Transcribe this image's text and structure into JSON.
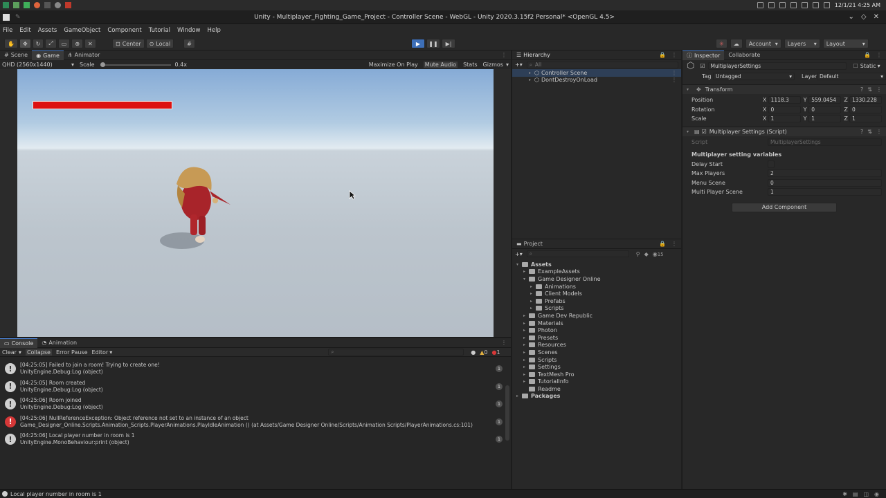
{
  "os_bar": {
    "datetime": "12/1/21   4:25 AM"
  },
  "window": {
    "title": "Unity - Multiplayer_Fighting_Game_Project - Controller Scene - WebGL - Unity 2020.3.15f2 Personal* <OpenGL 4.5>"
  },
  "menu": [
    "File",
    "Edit",
    "Assets",
    "GameObject",
    "Component",
    "Tutorial",
    "Window",
    "Help"
  ],
  "toolbar": {
    "pivot_label": "Center",
    "space_label": "Local",
    "account_label": "Account",
    "layers_label": "Layers",
    "layout_label": "Layout"
  },
  "scene_panel": {
    "tabs": [
      "Scene",
      "Game",
      "Animator"
    ],
    "resolution": "QHD (2560x1440)",
    "scale_label": "Scale",
    "scale_value": "0.4x",
    "options": [
      "Maximize On Play",
      "Mute Audio",
      "Stats",
      "Gizmos"
    ],
    "health": 1.0
  },
  "hierarchy": {
    "title": "Hierarchy",
    "search_placeholder": "All",
    "items": [
      "Controller Scene",
      "DontDestroyOnLoad"
    ]
  },
  "project": {
    "title": "Project",
    "count": "15",
    "tree": [
      {
        "label": "Assets",
        "depth": 0,
        "bold": true
      },
      {
        "label": "ExampleAssets",
        "depth": 1
      },
      {
        "label": "Game Designer Online",
        "depth": 1
      },
      {
        "label": "Animations",
        "depth": 2
      },
      {
        "label": "Client Models",
        "depth": 2
      },
      {
        "label": "Prefabs",
        "depth": 2
      },
      {
        "label": "Scripts",
        "depth": 2
      },
      {
        "label": "Game Dev Republic",
        "depth": 1
      },
      {
        "label": "Materials",
        "depth": 1
      },
      {
        "label": "Photon",
        "depth": 1
      },
      {
        "label": "Presets",
        "depth": 1
      },
      {
        "label": "Resources",
        "depth": 1
      },
      {
        "label": "Scenes",
        "depth": 1
      },
      {
        "label": "Scripts",
        "depth": 1
      },
      {
        "label": "Settings",
        "depth": 1
      },
      {
        "label": "TextMesh Pro",
        "depth": 1
      },
      {
        "label": "TutorialInfo",
        "depth": 1
      },
      {
        "label": "Readme",
        "depth": 1
      },
      {
        "label": "Packages",
        "depth": 0,
        "bold": true
      }
    ]
  },
  "inspector": {
    "tabs": [
      "Inspector",
      "Collaborate"
    ],
    "object_name": "MultiplayerSettings",
    "static_label": "Static",
    "tag_label": "Tag",
    "tag_value": "Untagged",
    "layer_label": "Layer",
    "layer_value": "Default",
    "transform": {
      "title": "Transform",
      "position_label": "Position",
      "rotation_label": "Rotation",
      "scale_label": "Scale",
      "position": {
        "x": "1118.3",
        "y": "559.0454",
        "z": "1330.228"
      },
      "rotation": {
        "x": "0",
        "y": "0",
        "z": "0"
      },
      "scale": {
        "x": "1",
        "y": "1",
        "z": "1"
      }
    },
    "script_component": {
      "title": "Multiplayer Settings (Script)",
      "script_label": "Script",
      "script_value": "MultiplayerSettings",
      "section_title": "Multiplayer setting variables",
      "fields": [
        {
          "label": "Delay Start",
          "value": ""
        },
        {
          "label": "Max Players",
          "value": "2"
        },
        {
          "label": "Menu Scene",
          "value": "0"
        },
        {
          "label": "Multi Player Scene",
          "value": "1"
        }
      ]
    },
    "add_component_label": "Add Component"
  },
  "console": {
    "tabs": [
      "Console",
      "Animation"
    ],
    "toolbar": [
      "Clear",
      "Collapse",
      "Error Pause",
      "Editor"
    ],
    "counts": {
      "warn": "0",
      "err": "1"
    },
    "entries": [
      {
        "type": "info",
        "line1": "[04:25:05] Failed to join a room! Trying to create one!",
        "line2": "UnityEngine.Debug:Log (object)",
        "count": "1"
      },
      {
        "type": "info",
        "line1": "[04:25:05] Room created",
        "line2": "UnityEngine.Debug:Log (object)",
        "count": "1"
      },
      {
        "type": "info",
        "line1": "[04:25:06] Room joined",
        "line2": "UnityEngine.Debug:Log (object)",
        "count": "1"
      },
      {
        "type": "error",
        "line1": "[04:25:06] NullReferenceException: Object reference not set to an instance of an object",
        "line2": "Game_Designer_Online.Scripts.Animation_Scripts.PlayerAnimations.PlayIdleAnimation () (at Assets/Game Designer Online/Scripts/Animation Scripts/PlayerAnimations.cs:101)",
        "count": "1"
      },
      {
        "type": "info",
        "line1": "[04:25:06] Local player number in room is 1",
        "line2": "UnityEngine.MonoBehaviour:print (object)",
        "count": "1"
      }
    ]
  },
  "status_bar": {
    "message": "Local player number in room is 1"
  },
  "colors": {
    "health": "#dd1111",
    "accent": "#4a7fd0",
    "error": "#d63838"
  }
}
